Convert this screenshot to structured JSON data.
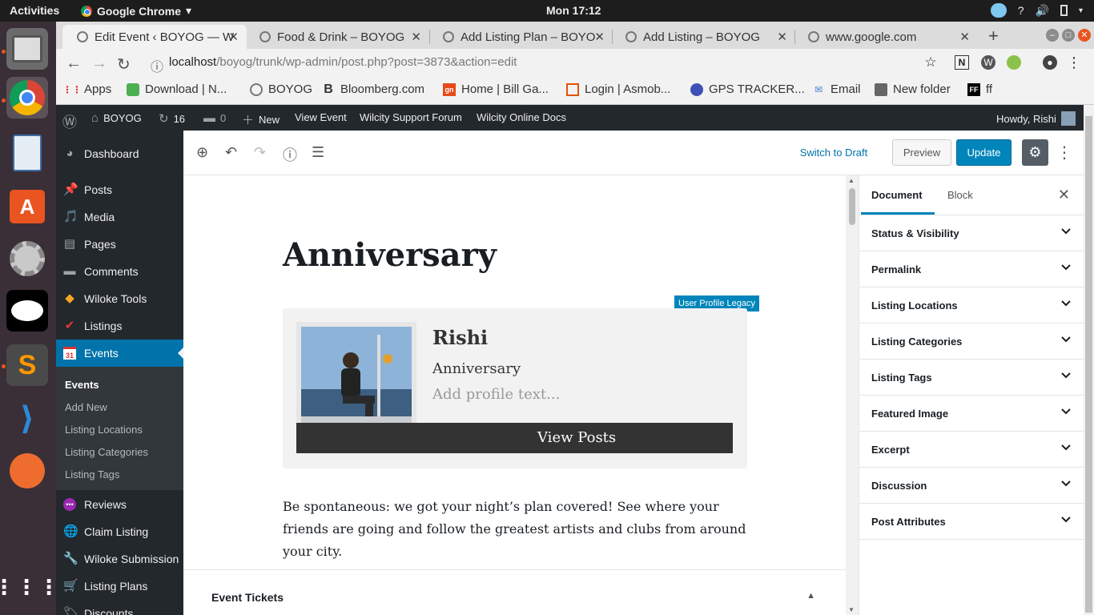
{
  "topbar": {
    "activities": "Activities",
    "app_name": "Google Chrome",
    "app_arrow": "▾",
    "clock": "Mon 17:12"
  },
  "dock": {
    "icons": [
      "files-icon",
      "chrome-icon",
      "document-viewer-icon",
      "software-center-icon",
      "settings-icon",
      "inkscape-icon",
      "sublime-text-icon",
      "vscode-icon",
      "postman-icon",
      "app-grid-icon"
    ]
  },
  "browser": {
    "tabs": [
      {
        "title": "Edit Event ‹ BOYOG — W",
        "active": true
      },
      {
        "title": "Food & Drink – BOYOG"
      },
      {
        "title": "Add Listing Plan – BOYO"
      },
      {
        "title": "Add Listing – BOYOG"
      },
      {
        "title": "www.google.com"
      }
    ],
    "new_tab": "+",
    "url_host": "localhost",
    "url_path": "/boyog/trunk/wp-admin/post.php?post=3873&action=edit",
    "bookmarks": [
      {
        "label": "Apps"
      },
      {
        "label": "Download | N..."
      },
      {
        "label": "BOYOG"
      },
      {
        "label": "Bloomberg.com"
      },
      {
        "label": "Home | Bill Ga..."
      },
      {
        "label": "Login | Asmob..."
      },
      {
        "label": "GPS TRACKER..."
      },
      {
        "label": "Email"
      },
      {
        "label": "New folder"
      },
      {
        "label": "ff"
      }
    ]
  },
  "adminbar": {
    "site": "BOYOG",
    "updates": "16",
    "comments": "0",
    "new": "New",
    "view_event": "View Event",
    "support": "Wilcity Support Forum",
    "docs": "Wilcity Online Docs",
    "howdy": "Howdy, Rishi"
  },
  "menu": {
    "items": [
      {
        "label": "Dashboard"
      },
      {
        "label": "Posts"
      },
      {
        "label": "Media"
      },
      {
        "label": "Pages"
      },
      {
        "label": "Comments"
      },
      {
        "label": "Wiloke Tools"
      },
      {
        "label": "Listings"
      },
      {
        "label": "Events",
        "current": true
      },
      {
        "label": "Reviews"
      },
      {
        "label": "Claim Listing"
      },
      {
        "label": "Wiloke Submission"
      },
      {
        "label": "Listing Plans"
      },
      {
        "label": "Discounts"
      }
    ],
    "events_icon_text": "31",
    "submenu": [
      "Events",
      "Add New",
      "Listing Locations",
      "Listing Categories",
      "Listing Tags"
    ]
  },
  "editor": {
    "switch_draft": "Switch to Draft",
    "preview": "Preview",
    "update": "Update",
    "title": "Anniversary",
    "block_badge": "User Profile Legacy",
    "profile_name": "Rishi",
    "profile_subtitle": "Anniversary",
    "profile_placeholder": "Add profile text...",
    "view_posts": "View Posts",
    "paragraph": "Be spontaneous: we got your night’s plan covered! See where your friends are going and follow the greatest artists and clubs from around your city.",
    "event_tickets": "Event Tickets"
  },
  "settings": {
    "tab_document": "Document",
    "tab_block": "Block",
    "panels": [
      "Status & Visibility",
      "Permalink",
      "Listing Locations",
      "Listing Categories",
      "Listing Tags",
      "Featured Image",
      "Excerpt",
      "Discussion",
      "Post Attributes"
    ]
  },
  "colors": {
    "wp_admin_bg": "#23282d",
    "wp_accent": "#0073aa",
    "update_button": "#0085ba",
    "dock_bg": "#3a2f37"
  }
}
